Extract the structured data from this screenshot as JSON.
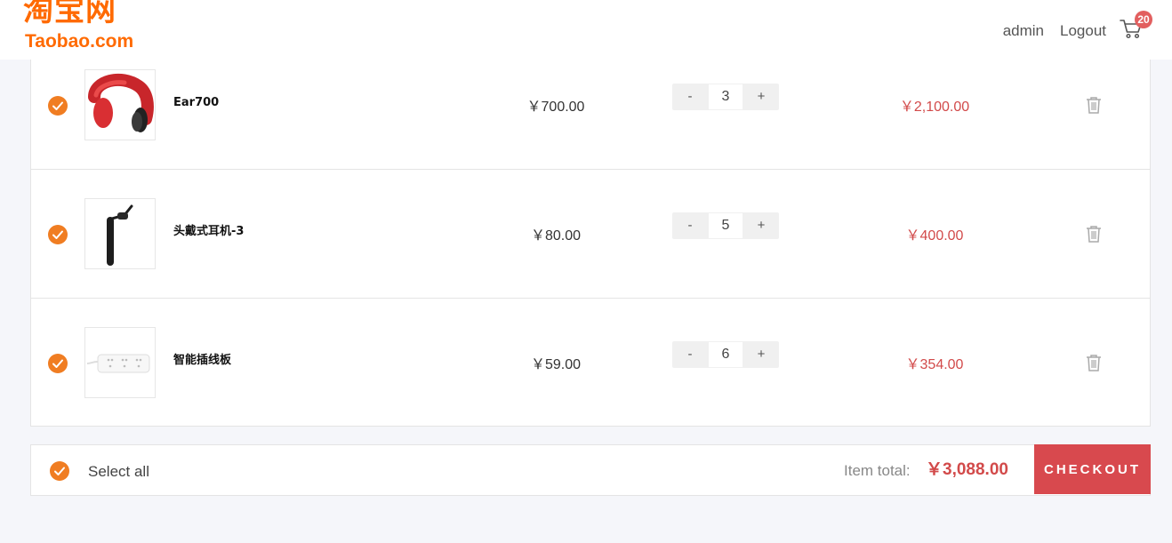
{
  "header": {
    "logo_cn": "淘宝网",
    "logo_en": "Taobao.com",
    "nav": {
      "admin": "admin",
      "logout": "Logout"
    },
    "cart_icon": "shopping-cart-icon",
    "cart_count": "20"
  },
  "cart": {
    "items": [
      {
        "name": "Ear700",
        "price": "￥700.00",
        "quantity": "3",
        "subtotal": "￥2,100.00",
        "image_icon": "red-headphones-image"
      },
      {
        "name": "头戴式耳机-3",
        "price": "￥80.00",
        "quantity": "5",
        "subtotal": "￥400.00",
        "image_icon": "black-bluetooth-earpiece-image"
      },
      {
        "name": "智能插线板",
        "price": "￥59.00",
        "quantity": "6",
        "subtotal": "￥354.00",
        "image_icon": "white-power-strip-image"
      }
    ],
    "stepper": {
      "minus": "-",
      "plus": "+"
    }
  },
  "footer": {
    "select_all": "Select all",
    "total_label": "Item total:",
    "total_value": "￥3,088.00",
    "checkout_label": "CHECKOUT"
  },
  "colors": {
    "brand_orange": "#ff6a00",
    "check_orange": "#f07d22",
    "price_red": "#d24a4a",
    "checkout_red": "#d8494e",
    "page_bg": "#f5f6fa"
  }
}
